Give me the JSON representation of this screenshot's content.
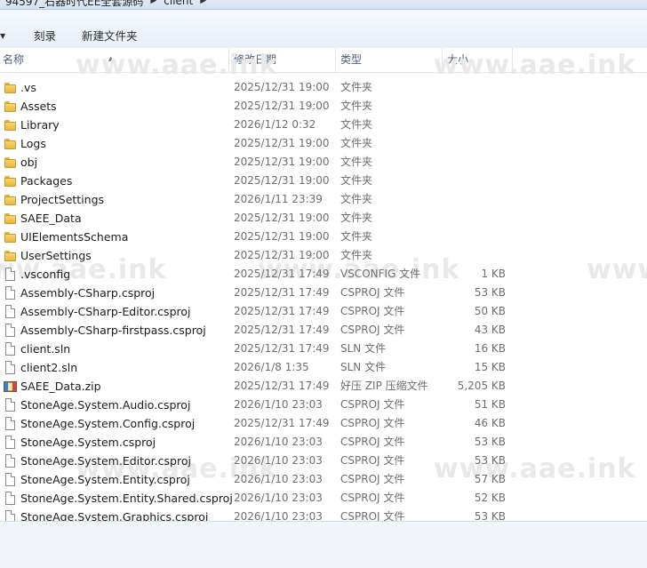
{
  "address_bar": {
    "crumbs": [
      "94597_石器时代EE全套源码",
      "client"
    ]
  },
  "toolbar": {
    "burn_label": "刻录",
    "new_folder_label": "新建文件夹"
  },
  "columns": {
    "name": "名称",
    "date": "修改日期",
    "type": "类型",
    "size": "大小"
  },
  "watermark": "www.aae.ink",
  "files": [
    {
      "name": ".vs",
      "date": "2025/12/31 19:00",
      "type": "文件夹",
      "size": "",
      "icon": "folder"
    },
    {
      "name": "Assets",
      "date": "2025/12/31 19:00",
      "type": "文件夹",
      "size": "",
      "icon": "folder"
    },
    {
      "name": "Library",
      "date": "2026/1/12 0:32",
      "type": "文件夹",
      "size": "",
      "icon": "folder"
    },
    {
      "name": "Logs",
      "date": "2025/12/31 19:00",
      "type": "文件夹",
      "size": "",
      "icon": "folder"
    },
    {
      "name": "obj",
      "date": "2025/12/31 19:00",
      "type": "文件夹",
      "size": "",
      "icon": "folder"
    },
    {
      "name": "Packages",
      "date": "2025/12/31 19:00",
      "type": "文件夹",
      "size": "",
      "icon": "folder"
    },
    {
      "name": "ProjectSettings",
      "date": "2026/1/11 23:39",
      "type": "文件夹",
      "size": "",
      "icon": "folder"
    },
    {
      "name": "SAEE_Data",
      "date": "2025/12/31 19:00",
      "type": "文件夹",
      "size": "",
      "icon": "folder"
    },
    {
      "name": "UIElementsSchema",
      "date": "2025/12/31 19:00",
      "type": "文件夹",
      "size": "",
      "icon": "folder"
    },
    {
      "name": "UserSettings",
      "date": "2025/12/31 19:00",
      "type": "文件夹",
      "size": "",
      "icon": "folder"
    },
    {
      "name": ".vsconfig",
      "date": "2025/12/31 17:49",
      "type": "VSCONFIG 文件",
      "size": "1 KB",
      "icon": "file"
    },
    {
      "name": "Assembly-CSharp.csproj",
      "date": "2025/12/31 17:49",
      "type": "CSPROJ 文件",
      "size": "53 KB",
      "icon": "file"
    },
    {
      "name": "Assembly-CSharp-Editor.csproj",
      "date": "2025/12/31 17:49",
      "type": "CSPROJ 文件",
      "size": "50 KB",
      "icon": "file"
    },
    {
      "name": "Assembly-CSharp-firstpass.csproj",
      "date": "2025/12/31 17:49",
      "type": "CSPROJ 文件",
      "size": "43 KB",
      "icon": "file"
    },
    {
      "name": "client.sln",
      "date": "2025/12/31 17:49",
      "type": "SLN 文件",
      "size": "16 KB",
      "icon": "file"
    },
    {
      "name": "client2.sln",
      "date": "2026/1/8 1:35",
      "type": "SLN 文件",
      "size": "15 KB",
      "icon": "file"
    },
    {
      "name": "SAEE_Data.zip",
      "date": "2025/12/31 17:49",
      "type": "好压 ZIP 压缩文件",
      "size": "5,205 KB",
      "icon": "zip"
    },
    {
      "name": "StoneAge.System.Audio.csproj",
      "date": "2026/1/10 23:03",
      "type": "CSPROJ 文件",
      "size": "51 KB",
      "icon": "file"
    },
    {
      "name": "StoneAge.System.Config.csproj",
      "date": "2025/12/31 17:49",
      "type": "CSPROJ 文件",
      "size": "46 KB",
      "icon": "file"
    },
    {
      "name": "StoneAge.System.csproj",
      "date": "2026/1/10 23:03",
      "type": "CSPROJ 文件",
      "size": "53 KB",
      "icon": "file"
    },
    {
      "name": "StoneAge.System.Editor.csproj",
      "date": "2026/1/10 23:03",
      "type": "CSPROJ 文件",
      "size": "53 KB",
      "icon": "file"
    },
    {
      "name": "StoneAge.System.Entity.csproj",
      "date": "2026/1/10 23:03",
      "type": "CSPROJ 文件",
      "size": "57 KB",
      "icon": "file"
    },
    {
      "name": "StoneAge.System.Entity.Shared.csproj",
      "date": "2026/1/10 23:03",
      "type": "CSPROJ 文件",
      "size": "52 KB",
      "icon": "file"
    },
    {
      "name": "StoneAge.System.Graphics.csproj",
      "date": "2026/1/10 23:03",
      "type": "CSPROJ 文件",
      "size": "53 KB",
      "icon": "file"
    }
  ]
}
